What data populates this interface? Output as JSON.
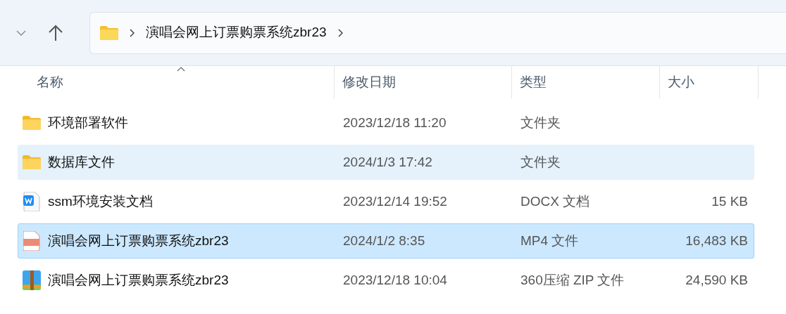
{
  "address_bar": {
    "path": [
      "演唱会网上订票购票系统zbr23"
    ]
  },
  "columns": [
    {
      "label": "名称",
      "sorted": true
    },
    {
      "label": "修改日期",
      "sorted": false
    },
    {
      "label": "类型",
      "sorted": false
    },
    {
      "label": "大小",
      "sorted": false
    }
  ],
  "rows": [
    {
      "kind": "folder",
      "name": "环境部署软件",
      "modified": "2023/12/18 11:20",
      "type": "文件夹",
      "selected": false,
      "hovered": false
    },
    {
      "kind": "folder",
      "name": "数据库文件",
      "modified": "2024/1/3 17:42",
      "type": "文件夹",
      "selected": false,
      "hovered": true
    },
    {
      "kind": "docx",
      "name": "ssm环境安装文档",
      "modified": "2023/12/14 19:52",
      "type": "DOCX 文档",
      "size": "15 KB",
      "selected": false,
      "hovered": false
    },
    {
      "kind": "mp4",
      "name": "演唱会网上订票购票系统zbr23",
      "modified": "2024/1/2 8:35",
      "type": "MP4 文件",
      "size": "16,483 KB",
      "selected": true,
      "hovered": false
    },
    {
      "kind": "zip",
      "name": "演唱会网上订票购票系统zbr23",
      "modified": "2023/12/18 10:04",
      "type": "360压缩 ZIP 文件",
      "size": "24,590 KB",
      "selected": false,
      "hovered": false
    }
  ]
}
